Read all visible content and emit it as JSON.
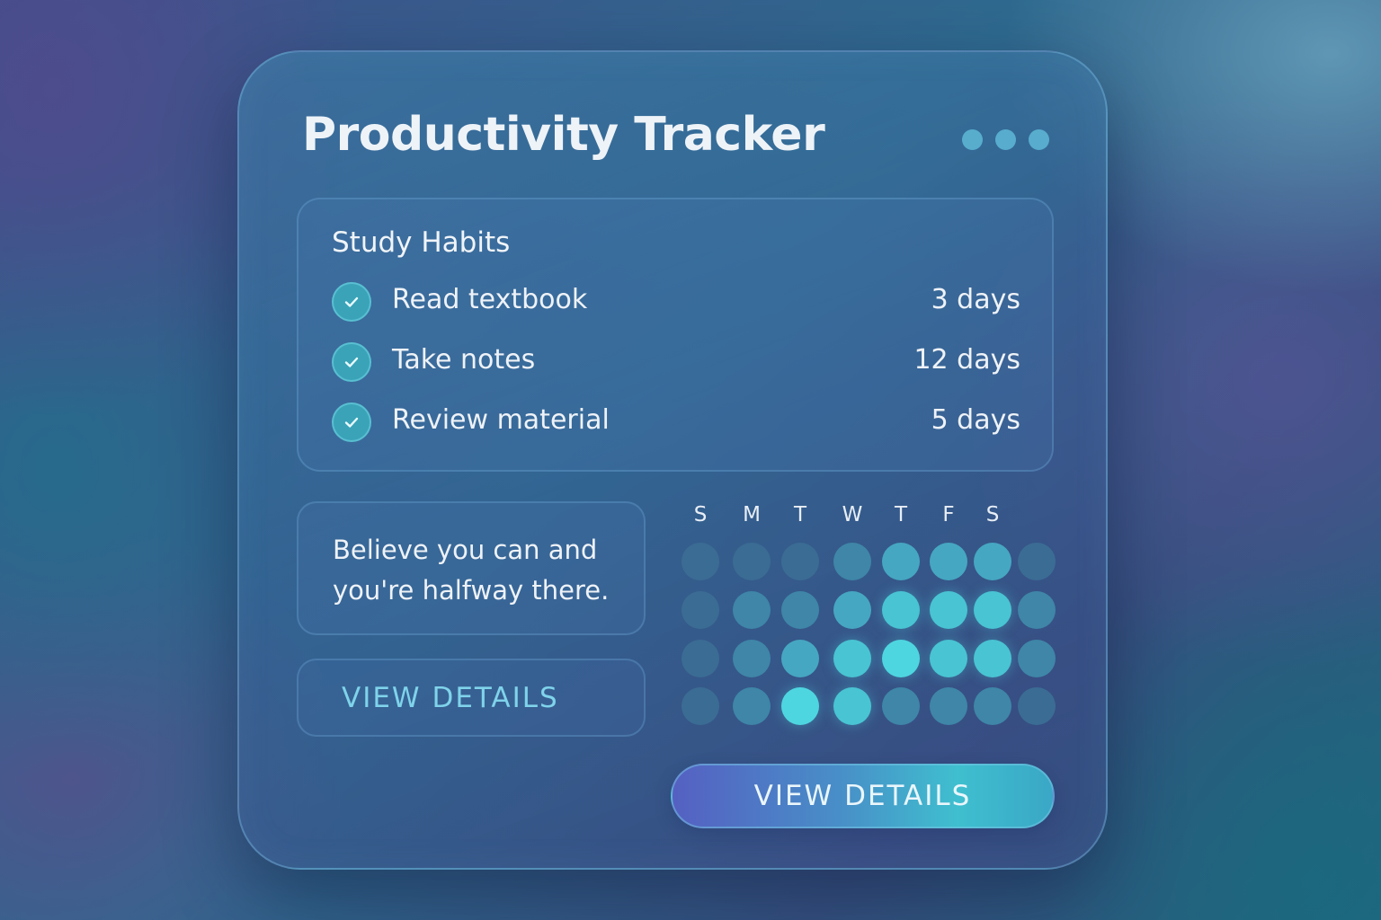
{
  "card": {
    "title": "Productivity Tracker",
    "menu_icon": "more-dots-icon"
  },
  "habits": {
    "title": "Study Habits",
    "items": [
      {
        "label": "Read textbook",
        "days": "3 days",
        "icon": "check-circle-icon"
      },
      {
        "label": "Take notes",
        "days": "12 days",
        "icon": "check-circle-icon"
      },
      {
        "label": "Review material",
        "days": "5 days",
        "icon": "check-circle-icon"
      }
    ]
  },
  "quote": {
    "lines": [
      "Believe you can and",
      "you're halfway there."
    ]
  },
  "secondary_button": {
    "label": "VIEW DETAILS"
  },
  "primary_button": {
    "label": "VIEW DETAILS"
  },
  "calendar": {
    "day_labels": [
      "S",
      "M",
      "T",
      "W",
      "T",
      "F",
      "S"
    ],
    "activity_levels": [
      [
        1,
        1,
        1,
        2,
        3,
        3,
        3,
        1
      ],
      [
        1,
        2,
        2,
        3,
        4,
        4,
        4,
        2
      ],
      [
        1,
        2,
        3,
        4,
        5,
        4,
        4,
        2
      ],
      [
        1,
        2,
        5,
        4,
        2,
        2,
        2,
        1
      ]
    ]
  },
  "colors": {
    "level_1": "#3b6c94",
    "level_2": "#3f86a8",
    "level_3": "#46a7c2",
    "level_4": "#49c4d3",
    "level_5": "#4ed6e0",
    "accent_text": "#7fd3ea"
  }
}
